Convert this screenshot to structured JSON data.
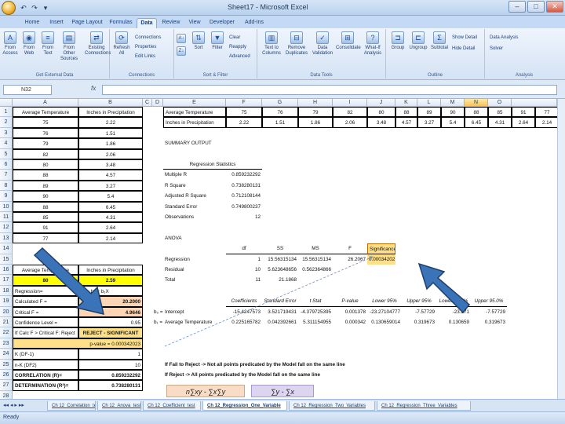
{
  "window": {
    "title": "Sheet17 - Microsoft Excel"
  },
  "quick_access": [
    "↶",
    "↷",
    "▾"
  ],
  "window_buttons": [
    "–",
    "□",
    "✕"
  ],
  "tabs": [
    "Home",
    "Insert",
    "Page Layout",
    "Formulas",
    "Data",
    "Review",
    "View",
    "Developer",
    "Add-Ins"
  ],
  "active_tab": "Data",
  "ribbon": {
    "groups": [
      "Get External Data",
      "Connections",
      "Sort & Filter",
      "Data Tools",
      "Outline",
      "Analysis"
    ],
    "big_buttons": {
      "from_access": "From Access",
      "from_web": "From Web",
      "from_text": "From Text",
      "from_other": "From Other Sources",
      "existing": "Existing Connections",
      "refresh": "Refresh All",
      "sort": "Sort",
      "filter": "Filter",
      "text_to_columns": "Text to Columns",
      "remove_duplicates": "Remove Duplicates",
      "data_validation": "Data Validation",
      "consolidate": "Consolidate",
      "what_if": "What-If Analysis",
      "group": "Group",
      "ungroup": "Ungroup",
      "subtotal": "Subtotal"
    },
    "small_buttons": {
      "connections": "Connections",
      "properties": "Properties",
      "edit_links": "Edit Links",
      "clear": "Clear",
      "reapply": "Reapply",
      "advanced": "Advanced",
      "show_detail": "Show Detail",
      "hide_detail": "Hide Detail",
      "data_analysis": "Data Analysis",
      "solver": "Solver"
    }
  },
  "formula_bar": {
    "name_box": "N32",
    "fx": "fx",
    "value": ""
  },
  "columns": [
    "A",
    "B",
    "C",
    "D",
    "E",
    "F",
    "G",
    "H",
    "I",
    "J",
    "K",
    "L",
    "M",
    "N",
    "O"
  ],
  "selected_column": "N",
  "rows": [
    "1",
    "2",
    "3",
    "4",
    "5",
    "6",
    "7",
    "8",
    "9",
    "10",
    "11",
    "12",
    "13",
    "14",
    "15",
    "16",
    "17",
    "18",
    "19",
    "20",
    "21",
    "22",
    "23",
    "24",
    "25",
    "26",
    "27",
    "28"
  ],
  "left_table": {
    "header_a": "Average Temperature",
    "header_b": "Inches in Precipitation",
    "data": [
      [
        "75",
        "2.22"
      ],
      [
        "76",
        "1.51"
      ],
      [
        "79",
        "1.86"
      ],
      [
        "82",
        "2.06"
      ],
      [
        "80",
        "3.48"
      ],
      [
        "88",
        "4.57"
      ],
      [
        "89",
        "3.27"
      ],
      [
        "90",
        "5.4"
      ],
      [
        "88",
        "6.45"
      ],
      [
        "85",
        "4.31"
      ],
      [
        "91",
        "2.64"
      ],
      [
        "77",
        "2.14"
      ]
    ]
  },
  "predict": {
    "header_a": "Average Temperature",
    "header_b": "Inches in Precipitation",
    "a_val": "80",
    "b_val": "2.59"
  },
  "reg": {
    "r18_a": "Regression=",
    "r18_b": "Y' = b₀ + b₁X",
    "r19_a": "Calculated F =",
    "r19_b": "20.2000",
    "r20_a": "Critical F =",
    "r20_b": "4.9646",
    "r21_a": "Confidence Level =",
    "r21_b": "0.95",
    "r22_a": "If Calc F > Critical F: Reject",
    "r22_b": "REJECT - SIGNIFICANT",
    "r23_b": "p-value = 0.000342023",
    "r24_a": "K (DF-1)",
    "r24_b": "1",
    "r25_a": "n-K (DF2)",
    "r25_b": "10",
    "r26_a": "CORRELATION (R)=",
    "r26_b": "0.859232292",
    "r27_a": "DETERMINATION (R²)=",
    "r27_b": "0.738280131"
  },
  "transposed": {
    "label_temp": "Average Temperature",
    "label_precip": "Inches in Precipitation",
    "temps": [
      "75",
      "76",
      "79",
      "82",
      "80",
      "88",
      "89",
      "90",
      "88",
      "85",
      "91",
      "77"
    ],
    "precip": [
      "2.22",
      "1.51",
      "1.86",
      "2.06",
      "3.48",
      "4.57",
      "3.27",
      "5.4",
      "6.45",
      "4.31",
      "2.64",
      "2.14"
    ]
  },
  "summary": {
    "title": "SUMMARY OUTPUT",
    "stats_header": "Regression Statistics",
    "stats": [
      [
        "Multiple R",
        "0.859232292"
      ],
      [
        "R Square",
        "0.738280131"
      ],
      [
        "Adjusted R Square",
        "0.712108144"
      ],
      [
        "Standard Error",
        "0.749800237"
      ],
      [
        "Observations",
        "12"
      ]
    ]
  },
  "anova": {
    "title": "ANOVA",
    "headers": [
      "df",
      "SS",
      "MS",
      "F",
      "Significance F"
    ],
    "rows": [
      [
        "Regression",
        "1",
        "15.56315134",
        "15.56315134",
        "26.2067",
        "0.00034202"
      ],
      [
        "Residual",
        "10",
        "5.623648656",
        "0.562364866",
        "",
        ""
      ],
      [
        "Total",
        "11",
        "21.1868",
        "",
        "",
        ""
      ]
    ]
  },
  "coef": {
    "headers": [
      "Coefficients",
      "Standard Error",
      "t Stat",
      "P-value",
      "Lower 95%",
      "Upper 95%",
      "Lower 95.0%",
      "Upper 95.0%"
    ],
    "rows": [
      [
        "b₀ =",
        "Intercept",
        "-15.4247573",
        "3.521719431",
        "-4.379725395",
        "0.001378",
        "-23.27104777",
        "-7.57729",
        "-23.271",
        "-7.57729"
      ],
      [
        "b₁ =",
        "Average Temperature",
        "0.225165782",
        "0.042392661",
        "5.311154955",
        "0.000342",
        "0.130659014",
        "0.319673",
        "0.130659",
        "0.319673"
      ]
    ]
  },
  "notes": [
    "If Fail to Reject -> Not all points predicated by the Model fall on the same line",
    "If Reject -> All points predicated by the Model fall on the same line"
  ],
  "formula_images": [
    "n∑xy - ∑x∑y",
    "∑y - ∑x"
  ],
  "sheet_tabs": [
    "Ch 12_Correlation_test",
    "Ch 12_Anova_test",
    "Ch 12_Coefficient_test",
    "Ch 12_Regression_One_Variable",
    "Ch 12_Regression_Two_Variables",
    "Ch 12_Regression_Three_Variables"
  ],
  "active_sheet_index": 3,
  "status": {
    "ready": "Ready"
  },
  "colors": {
    "arrow": "#3b73b9",
    "highlight": "#ffff00",
    "pink": "#fbd5b5",
    "orange": "#ffe08a"
  }
}
